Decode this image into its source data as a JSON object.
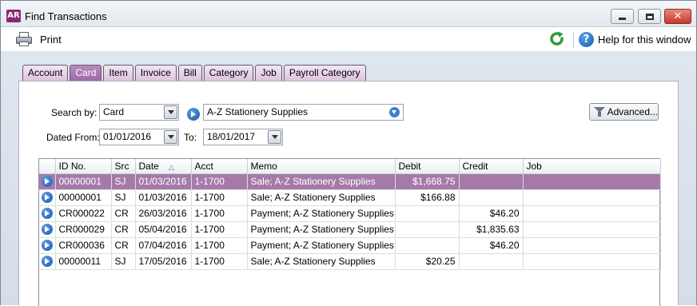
{
  "window": {
    "app_icon": "AR",
    "title": "Find Transactions"
  },
  "toolbar": {
    "print_label": "Print",
    "refresh_icon": "refresh-icon",
    "help_label": "Help for this window"
  },
  "tabs": [
    {
      "label": "Account",
      "active": false
    },
    {
      "label": "Card",
      "active": true
    },
    {
      "label": "Item",
      "active": false
    },
    {
      "label": "Invoice",
      "active": false
    },
    {
      "label": "Bill",
      "active": false
    },
    {
      "label": "Category",
      "active": false
    },
    {
      "label": "Job",
      "active": false
    },
    {
      "label": "Payroll Category",
      "active": false
    }
  ],
  "filters": {
    "search_by_label": "Search by:",
    "search_by_value": "Card",
    "card_value": "A-Z Stationery Supplies",
    "dated_from_label": "Dated From:",
    "dated_from_value": "01/01/2016",
    "to_label": "To:",
    "to_value": "18/01/2017",
    "advanced_label": "Advanced..."
  },
  "table": {
    "columns": [
      "ID No.",
      "Src",
      "Date",
      "Acct",
      "Memo",
      "Debit",
      "Credit",
      "Job"
    ],
    "sort_column": "Date",
    "sort_indicator": "△",
    "rows": [
      {
        "id": "00000001",
        "src": "SJ",
        "date": "01/03/2016",
        "acct": "1-1700",
        "memo": "Sale; A-Z Stationery Supplies",
        "debit": "$1,668.75",
        "credit": "",
        "job": "",
        "selected": true
      },
      {
        "id": "00000001",
        "src": "SJ",
        "date": "01/03/2016",
        "acct": "1-1700",
        "memo": "Sale; A-Z Stationery Supplies",
        "debit": "$166.88",
        "credit": "",
        "job": "",
        "selected": false
      },
      {
        "id": "CR000022",
        "src": "CR",
        "date": "26/03/2016",
        "acct": "1-1700",
        "memo": "Payment; A-Z Stationery Supplies",
        "debit": "",
        "credit": "$46.20",
        "job": "",
        "selected": false
      },
      {
        "id": "CR000029",
        "src": "CR",
        "date": "05/04/2016",
        "acct": "1-1700",
        "memo": "Payment; A-Z Stationery Supplies",
        "debit": "",
        "credit": "$1,835.63",
        "job": "",
        "selected": false
      },
      {
        "id": "CR000036",
        "src": "CR",
        "date": "07/04/2016",
        "acct": "1-1700",
        "memo": "Payment; A-Z Stationery Supplies",
        "debit": "",
        "credit": "$46.20",
        "job": "",
        "selected": false
      },
      {
        "id": "00000011",
        "src": "SJ",
        "date": "17/05/2016",
        "acct": "1-1700",
        "memo": "Sale; A-Z Stationery Supplies",
        "debit": "$20.25",
        "credit": "",
        "job": "",
        "selected": false
      }
    ]
  }
}
